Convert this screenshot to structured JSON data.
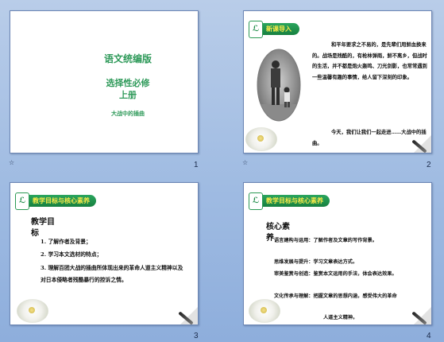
{
  "slides": [
    {
      "number": "1",
      "title": "语文统编版",
      "subtitle_line1": "选择性必修",
      "subtitle_line2": "上册",
      "lesson": "大战中的插曲"
    },
    {
      "number": "2",
      "badge": "新课导入",
      "para1": "和平年要求之不易的，是先辈们用鲜血换来的。战场是残酷的，有枪林弹雨，鲜不离乡，但战时的生活，并不都是炮火轰鸣、刀光剑影，也常常遇到一些温馨有趣的事情，给人留下深刻的印象。",
      "para2": "今天，我们让我们一起走进……大战中的插曲。"
    },
    {
      "number": "3",
      "badge": "教学目标与核心素养",
      "heading_line1": "教学目",
      "heading_line2": "标",
      "items": [
        "1. 了解作者及背景；",
        "2. 学习本文选材的特点；",
        "3. 理解百团大战的插曲所体现出来的革命人道主义精神以及对日本侵略者残酷暴行的控诉之情。"
      ]
    },
    {
      "number": "4",
      "badge": "教学目标与核心素养",
      "heading_line1": "核心素",
      "heading_line2": "养",
      "items": [
        "语言建构与运用：了解作者及文章的写作背景。",
        "思维发展与提升：学习文章表达方式。",
        "审美鉴赏与创造：鉴赏本文运用的手法，体会表达效果。",
        "文化传承与理解：把握文章的思想内涵，感受伟大的革命",
        "人道主义精神。"
      ]
    }
  ],
  "icons": {
    "transition": "star-transition-icon"
  }
}
